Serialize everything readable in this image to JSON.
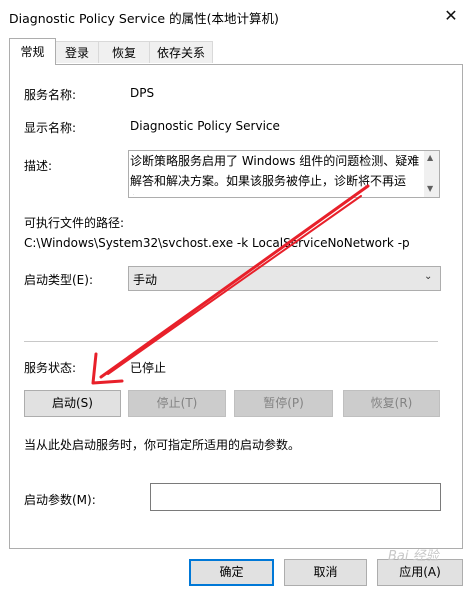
{
  "window": {
    "title": "Diagnostic Policy Service 的属性(本地计算机)",
    "close_glyph": "✕"
  },
  "tabs": [
    {
      "label": "常规",
      "active": true
    },
    {
      "label": "登录",
      "active": false
    },
    {
      "label": "恢复",
      "active": false
    },
    {
      "label": "依存关系",
      "active": false
    }
  ],
  "general": {
    "service_name_label": "服务名称:",
    "service_name": "DPS",
    "display_name_label": "显示名称:",
    "display_name": "Diagnostic Policy Service",
    "description_label": "描述:",
    "description": "诊断策略服务启用了 Windows 组件的问题检测、疑难解答和解决方案。如果该服务被停止，诊断将不再运行。",
    "exe_path_label": "可执行文件的路径:",
    "exe_path": "C:\\Windows\\System32\\svchost.exe -k LocalServiceNoNetwork -p",
    "startup_type_label": "启动类型(E):",
    "startup_type_value": "手动",
    "status_label": "服务状态:",
    "status_value": "已停止",
    "start_button": "启动(S)",
    "stop_button": "停止(T)",
    "pause_button": "暂停(P)",
    "resume_button": "恢复(R)",
    "hint": "当从此处启动服务时，你可指定所适用的启动参数。",
    "params_label": "启动参数(M):",
    "params_value": ""
  },
  "footer": {
    "ok": "确定",
    "cancel": "取消",
    "apply": "应用(A)"
  },
  "watermark": "Bai 经验",
  "annotation_color": "#e8202a"
}
